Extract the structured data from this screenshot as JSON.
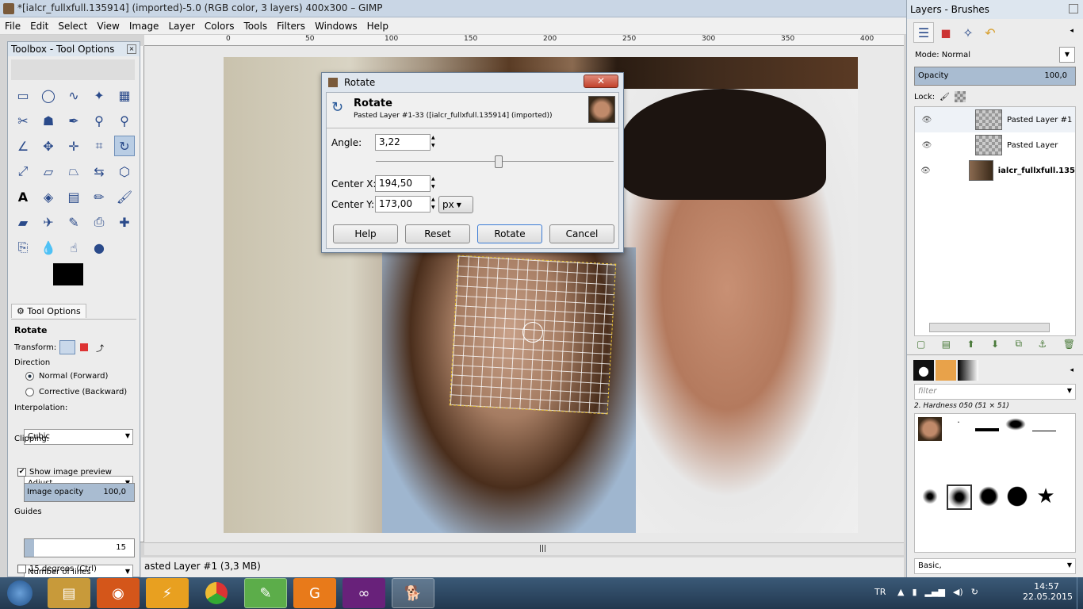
{
  "window": {
    "title": "*[ialcr_fullxfull.135914] (imported)-5.0 (RGB color, 3 layers) 400x300 – GIMP",
    "status": "asted Layer #1 (3,3 MB)"
  },
  "menu": [
    "File",
    "Edit",
    "Select",
    "View",
    "Image",
    "Layer",
    "Colors",
    "Tools",
    "Filters",
    "Windows",
    "Help"
  ],
  "ruler": {
    "labels": [
      "0",
      "50",
      "100",
      "150",
      "200",
      "250",
      "300",
      "350",
      "400"
    ]
  },
  "toolbox": {
    "title": "Toolbox - Tool Options",
    "tool_options_tab": "Tool Options",
    "tool_name": "Rotate",
    "transform_label": "Transform:",
    "direction_label": "Direction",
    "direction_normal": "Normal (Forward)",
    "direction_corrective": "Corrective (Backward)",
    "interpolation_label": "Interpolation:",
    "interpolation_value": "Cubic",
    "clipping_label": "Clipping:",
    "clipping_value": "Adjust",
    "show_preview": "Show image preview",
    "image_opacity_label": "Image opacity",
    "image_opacity_value": "100,0",
    "guides_label": "Guides",
    "guides_value": "Number of lines",
    "guides_count": "15",
    "degrees_label": "15 degrees  (Ctrl)"
  },
  "dialog": {
    "title": "Rotate",
    "heading": "Rotate",
    "subheading": "Pasted Layer #1-33 ([ialcr_fullxfull.135914] (imported))",
    "angle_label": "Angle:",
    "angle_value": "3,22",
    "center_x_label": "Center X:",
    "center_x_value": "194,50",
    "center_y_label": "Center Y:",
    "center_y_value": "173,00",
    "unit": "px",
    "buttons": [
      "Help",
      "Reset",
      "Rotate",
      "Cancel"
    ]
  },
  "layers_panel": {
    "title": "Layers - Brushes",
    "mode_label": "Mode: Normal",
    "opacity_label": "Opacity",
    "opacity_value": "100,0",
    "lock_label": "Lock:",
    "layers": [
      "Pasted Layer #1",
      "Pasted Layer",
      "ialcr_fullxfull.135"
    ],
    "filter_placeholder": "filter",
    "brush_name": "2. Hardness 050 (51 × 51)",
    "brush_tag": "Basic,"
  },
  "taskbar": {
    "lang": "TR",
    "time": "14:57",
    "date": "22.05.2015"
  }
}
